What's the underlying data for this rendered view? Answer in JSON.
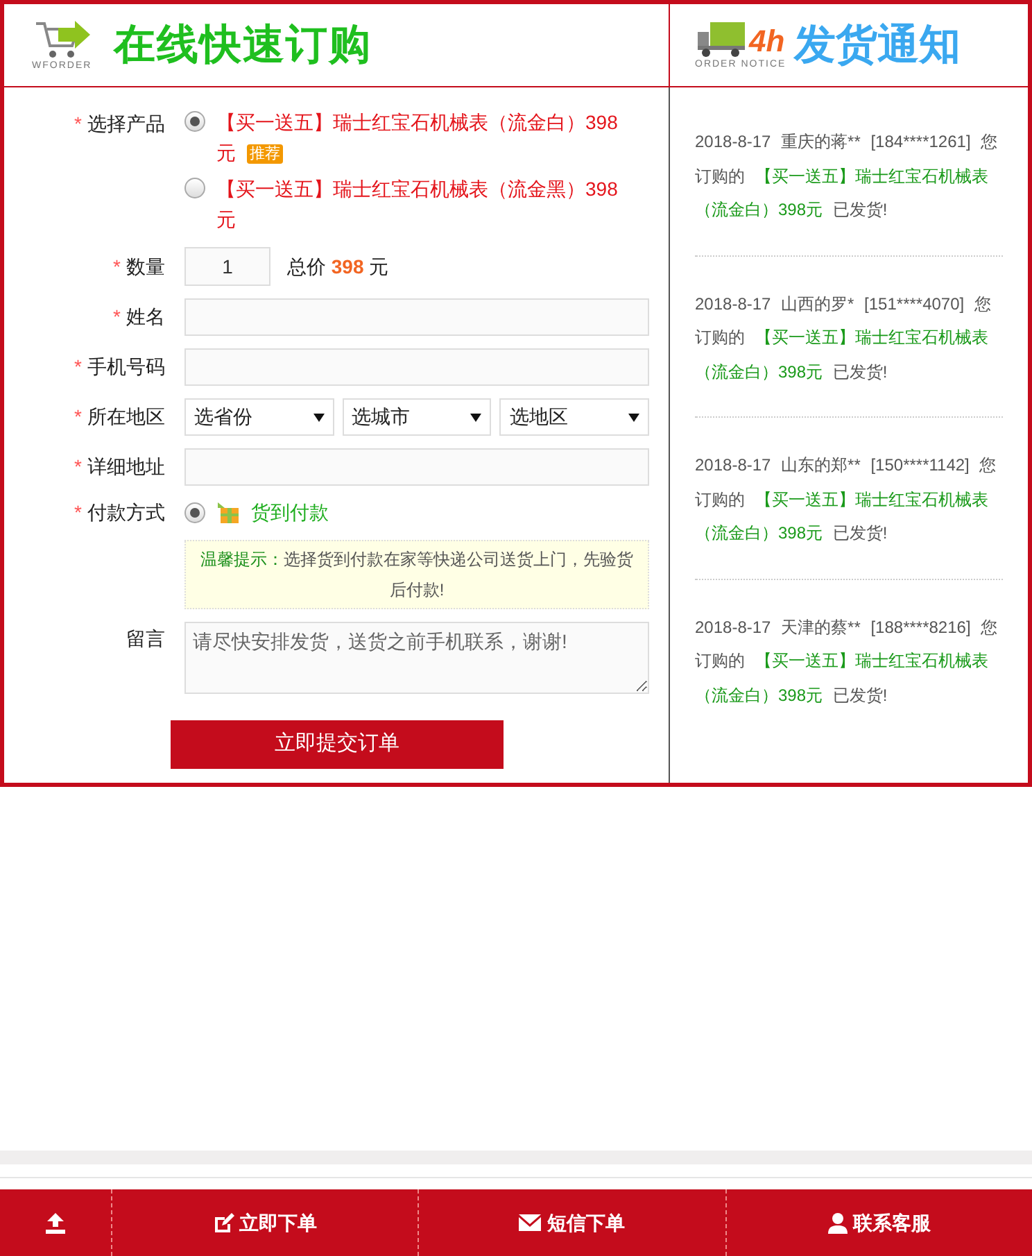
{
  "header": {
    "left_caption": "WFORDER",
    "left_title": "在线快速订购",
    "right_badge": "4h",
    "right_caption": "ORDER NOTICE",
    "right_title": "发货通知"
  },
  "form": {
    "required_mark": "*",
    "product": {
      "label": "选择产品",
      "required": true,
      "options": [
        {
          "text": "【买一送五】瑞士红宝石机械表（流金白）398元",
          "badge": "推荐",
          "selected": true
        },
        {
          "text": "【买一送五】瑞士红宝石机械表（流金黑）398元",
          "selected": false
        }
      ]
    },
    "quantity": {
      "label": "数量",
      "required": true,
      "value": "1",
      "total_label": "总价",
      "total": "398",
      "unit": "元"
    },
    "fields": [
      {
        "label": "姓名",
        "required": true
      },
      {
        "label": "手机号码",
        "required": true
      }
    ],
    "region": {
      "label": "所在地区",
      "required": true,
      "selects": [
        "选省份",
        "选城市",
        "选地区"
      ]
    },
    "address": {
      "label": "详细地址",
      "required": true
    },
    "payment": {
      "label": "付款方式",
      "required": true,
      "options": [
        {
          "text": "货到付款",
          "selected": true
        }
      ]
    },
    "tip": {
      "title": "温馨提示：",
      "text": "选择货到付款在家等快递公司送货上门，先验货后付款!"
    },
    "message": {
      "label": "留言",
      "required": false,
      "placeholder": "请尽快安排发货，送货之前手机联系，谢谢!"
    },
    "submit": "立即提交订单"
  },
  "notices": [
    {
      "date": "2018-8-17",
      "buyer": "重庆的蒋**",
      "phone": "[184****1261]",
      "prefix": "您订购的",
      "product": "【买一送五】瑞士红宝石机械表（流金白）398元",
      "suffix": "已发货!"
    },
    {
      "date": "2018-8-17",
      "buyer": "山西的罗*",
      "phone": "[151****4070]",
      "prefix": "您订购的",
      "product": "【买一送五】瑞士红宝石机械表（流金白）398元",
      "suffix": "已发货!"
    },
    {
      "date": "2018-8-17",
      "buyer": "山东的郑**",
      "phone": "[150****1142]",
      "prefix": "您订购的",
      "product": "【买一送五】瑞士红宝石机械表（流金白）398元",
      "suffix": "已发货!"
    },
    {
      "date": "2018-8-17",
      "buyer": "天津的蔡**",
      "phone": "[188****8216]",
      "prefix": "您订购的",
      "product": "【买一送五】瑞士红宝石机械表（流金白）398元",
      "suffix": "已发货!"
    }
  ],
  "bottom_bar": [
    {
      "kind": "top"
    },
    {
      "kind": "order",
      "label": "立即下单"
    },
    {
      "kind": "sms",
      "label": "短信下单"
    },
    {
      "kind": "service",
      "label": "联系客服"
    }
  ]
}
